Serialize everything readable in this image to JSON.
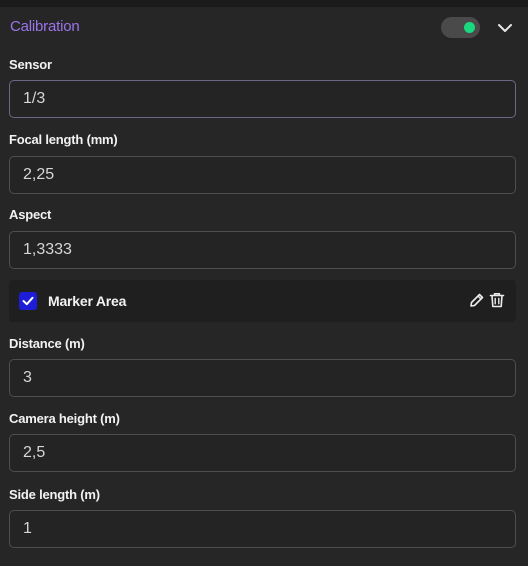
{
  "header": {
    "title": "Calibration",
    "toggle_on": true,
    "accent_color": "#9a74ea",
    "toggle_color": "#19d97e",
    "collapse_icon": "chevron-down-icon"
  },
  "fields": {
    "sensor": {
      "label": "Sensor",
      "value": "1/3"
    },
    "focal_length": {
      "label": "Focal length (mm)",
      "value": "2,25"
    },
    "aspect": {
      "label": "Aspect",
      "value": "1,3333"
    },
    "distance": {
      "label": "Distance (m)",
      "value": "3"
    },
    "camera_height": {
      "label": "Camera height (m)",
      "value": "2,5"
    },
    "side_length": {
      "label": "Side length (m)",
      "value": "1"
    }
  },
  "marker_area": {
    "label": "Marker Area",
    "checked": true,
    "checkbox_color": "#1d1dd8",
    "icons": [
      "pencil-icon",
      "trash-icon"
    ]
  }
}
